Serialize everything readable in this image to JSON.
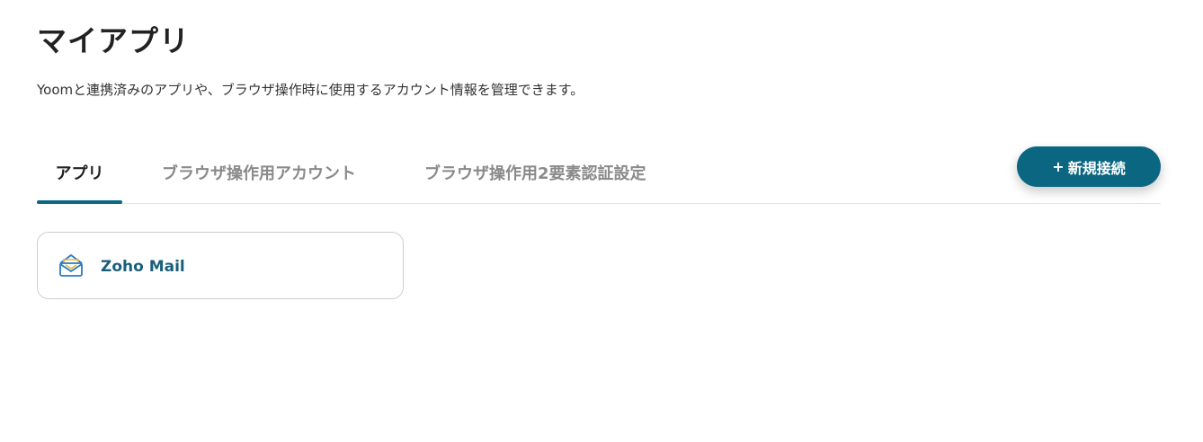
{
  "header": {
    "title": "マイアプリ",
    "description": "Yoomと連携済みのアプリや、ブラウザ操作時に使用するアカウント情報を管理できます。"
  },
  "tabs": [
    {
      "label": "アプリ",
      "active": true
    },
    {
      "label": "ブラウザ操作用アカウント",
      "active": false
    },
    {
      "label": "ブラウザ操作用2要素認証設定",
      "active": false
    }
  ],
  "actions": {
    "new_connection_plus": "+",
    "new_connection_label": "新規接続"
  },
  "apps": [
    {
      "name": "Zoho Mail",
      "icon": "zoho-mail-icon"
    }
  ],
  "colors": {
    "accent": "#0b6682",
    "app_name": "#1a5f7a",
    "inactive_tab": "#8a8a8a"
  }
}
